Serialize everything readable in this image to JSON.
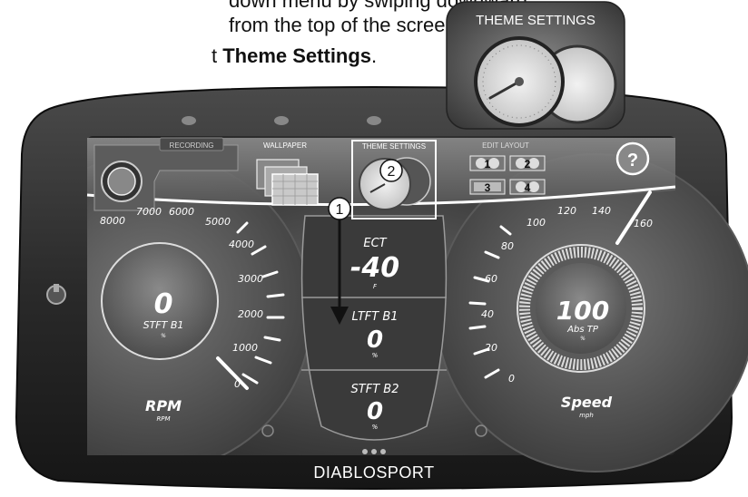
{
  "instructions": {
    "line1": "down menu by swiping downward",
    "line2": "from the top of the screen.",
    "line3_prefix": "t ",
    "line3_bold": "Theme Settings",
    "line3_suffix": "."
  },
  "callout": {
    "title": "THEME SETTINGS"
  },
  "menu": {
    "recording": "RECORDING",
    "wallpaper": "WALLPAPER",
    "theme_settings": "THEME SETTINGS",
    "edit_layout": "EDIT LAYOUT",
    "layouts": [
      "1",
      "2",
      "3",
      "4"
    ],
    "help": "?"
  },
  "steps": {
    "step1": "1",
    "step2": "2"
  },
  "left_gauge": {
    "ticks": [
      "8000",
      "7000",
      "6000",
      "5000",
      "4000",
      "3000",
      "2000",
      "1000",
      "0"
    ],
    "inner_value": "0",
    "inner_label": "STFT B1",
    "inner_unit": "%",
    "label": "RPM",
    "unit": "RPM"
  },
  "center": {
    "ect_label": "ECT",
    "ect_value": "-40",
    "ect_unit": "F",
    "ltft_label": "LTFT B1",
    "ltft_value": "0",
    "ltft_unit": "%",
    "stft_label": "STFT B2",
    "stft_value": "0",
    "stft_unit": "%"
  },
  "right_gauge": {
    "ticks": [
      "160",
      "140",
      "120",
      "100",
      "80",
      "60",
      "40",
      "20",
      "0"
    ],
    "inner_value": "100",
    "inner_label": "Abs TP",
    "inner_unit": "%",
    "label": "Speed",
    "unit": "mph"
  },
  "brand": "DIABLOSPORT",
  "colors": {
    "bezel": "#1e1e1e",
    "screen": "#3a3a3a",
    "accent": "#ffffff"
  }
}
